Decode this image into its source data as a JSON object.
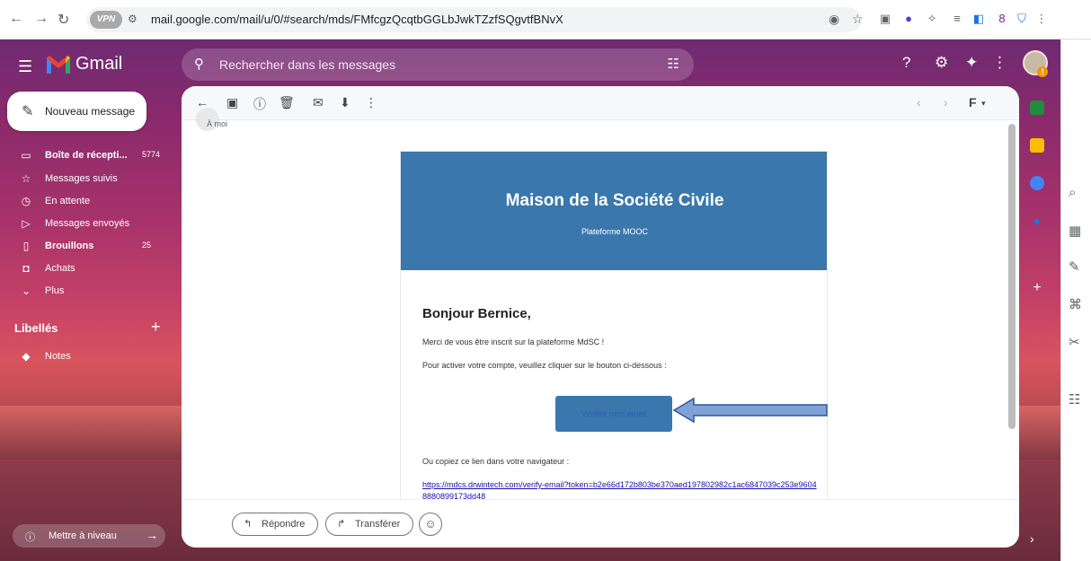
{
  "browser": {
    "url": "mail.google.com/mail/u/0/#search/mds/FMfcgzQcqtbGGLbJwkTZzfSQgvtfBNvX",
    "vpn_label": "VPN",
    "profile_num": "8"
  },
  "app": {
    "name": "Gmail",
    "search_placeholder": "Rechercher dans les messages"
  },
  "sidebar": {
    "compose_label": "Nouveau message",
    "items": [
      {
        "label": "Boîte de récepti...",
        "count": "5774",
        "icon": "inbox-icon",
        "bold": true
      },
      {
        "label": "Messages suivis",
        "count": "",
        "icon": "star-icon",
        "bold": false
      },
      {
        "label": "En attente",
        "count": "",
        "icon": "clock-icon",
        "bold": false
      },
      {
        "label": "Messages envoyés",
        "count": "",
        "icon": "send-icon",
        "bold": false
      },
      {
        "label": "Brouillons",
        "count": "25",
        "icon": "draft-icon",
        "bold": true
      },
      {
        "label": "Achats",
        "count": "",
        "icon": "shopping-icon",
        "bold": false
      },
      {
        "label": "Plus",
        "count": "",
        "icon": "chevron-down-icon",
        "bold": false
      }
    ],
    "labels_header": "Libellés",
    "labels": [
      {
        "label": "Notes",
        "icon": "label-icon"
      }
    ],
    "upgrade_label": "Mettre à niveau"
  },
  "toolbar": {
    "input_tool": "F"
  },
  "email": {
    "to_label": "À moi",
    "header_title": "Maison de la Société Civile",
    "header_subtitle": "Plateforme MOOC",
    "greeting": "Bonjour Bernice,",
    "p1": "Merci de vous être inscrit sur la plateforme MdSC !",
    "p2": "Pour activer votre compte, veuillez cliquer sur le bouton ci-dessous :",
    "verify_button": "Vérifier mon email",
    "p3": "Ou copiez ce lien dans votre navigateur :",
    "link": "https://mdcs.drwintech.com/verify-email?token=b2e66d172b803be370aed197802982c1ac6847039c253e96048880899173dd48"
  },
  "reply_bar": {
    "reply": "Répondre",
    "forward": "Transférer"
  },
  "colors": {
    "header_blue": "#3a77ad",
    "arrow_blue": "#7fa3d4"
  }
}
